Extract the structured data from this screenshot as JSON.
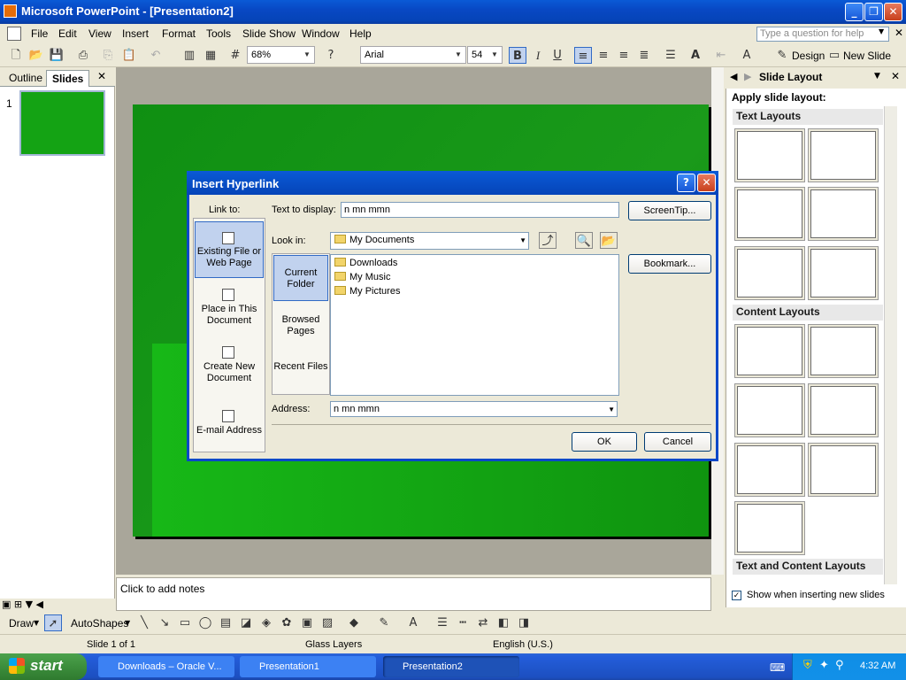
{
  "app": {
    "title": "Microsoft PowerPoint - [Presentation2]",
    "window_buttons": {
      "minimize": "_",
      "restore": "❐",
      "close": "✕"
    }
  },
  "menu": {
    "items": [
      "File",
      "Edit",
      "View",
      "Insert",
      "Format",
      "Tools",
      "Slide Show",
      "Window",
      "Help"
    ],
    "help_placeholder": "Type a question for help"
  },
  "toolbar": {
    "zoom": "68%",
    "font": "Arial",
    "font_size": "54",
    "bold": "B",
    "italic": "I",
    "underline": "U",
    "design_label": "Design",
    "new_slide_label": "New Slide"
  },
  "left_pane": {
    "tab_outline": "Outline",
    "tab_slides": "Slides",
    "close": "✕",
    "slide_number": "1"
  },
  "notes": {
    "placeholder": "Click to add notes"
  },
  "task_pane": {
    "title": "Slide Layout",
    "apply_label": "Apply slide layout:",
    "sections": {
      "text": "Text Layouts",
      "content": "Content Layouts",
      "text_content": "Text and Content Layouts"
    },
    "show_when_inserting": "Show when inserting new slides"
  },
  "dialog": {
    "title": "Insert Hyperlink",
    "help": "?",
    "close": "✕",
    "link_to_label": "Link to:",
    "link_to_options": [
      "Existing File or Web Page",
      "Place in This Document",
      "Create New Document",
      "E-mail Address"
    ],
    "text_to_display_label": "Text to display:",
    "text_to_display_value": "n mn mmn",
    "screentip": "ScreenTip...",
    "look_in_label": "Look in:",
    "look_in_value": "My Documents",
    "nav_options": [
      "Current Folder",
      "Browsed Pages",
      "Recent Files"
    ],
    "files": [
      "Downloads",
      "My Music",
      "My Pictures"
    ],
    "bookmark": "Bookmark...",
    "address_label": "Address:",
    "address_value": "n mn mmn",
    "ok": "OK",
    "cancel": "Cancel"
  },
  "drawbar": {
    "draw": "Draw",
    "autoshapes": "AutoShapes"
  },
  "status": {
    "slide": "Slide 1 of 1",
    "design": "Glass Layers",
    "language": "English (U.S.)"
  },
  "taskbar": {
    "start": "start",
    "tasks": [
      "Downloads – Oracle V...",
      "Presentation1",
      "Presentation2"
    ],
    "time": "4:32 AM"
  }
}
